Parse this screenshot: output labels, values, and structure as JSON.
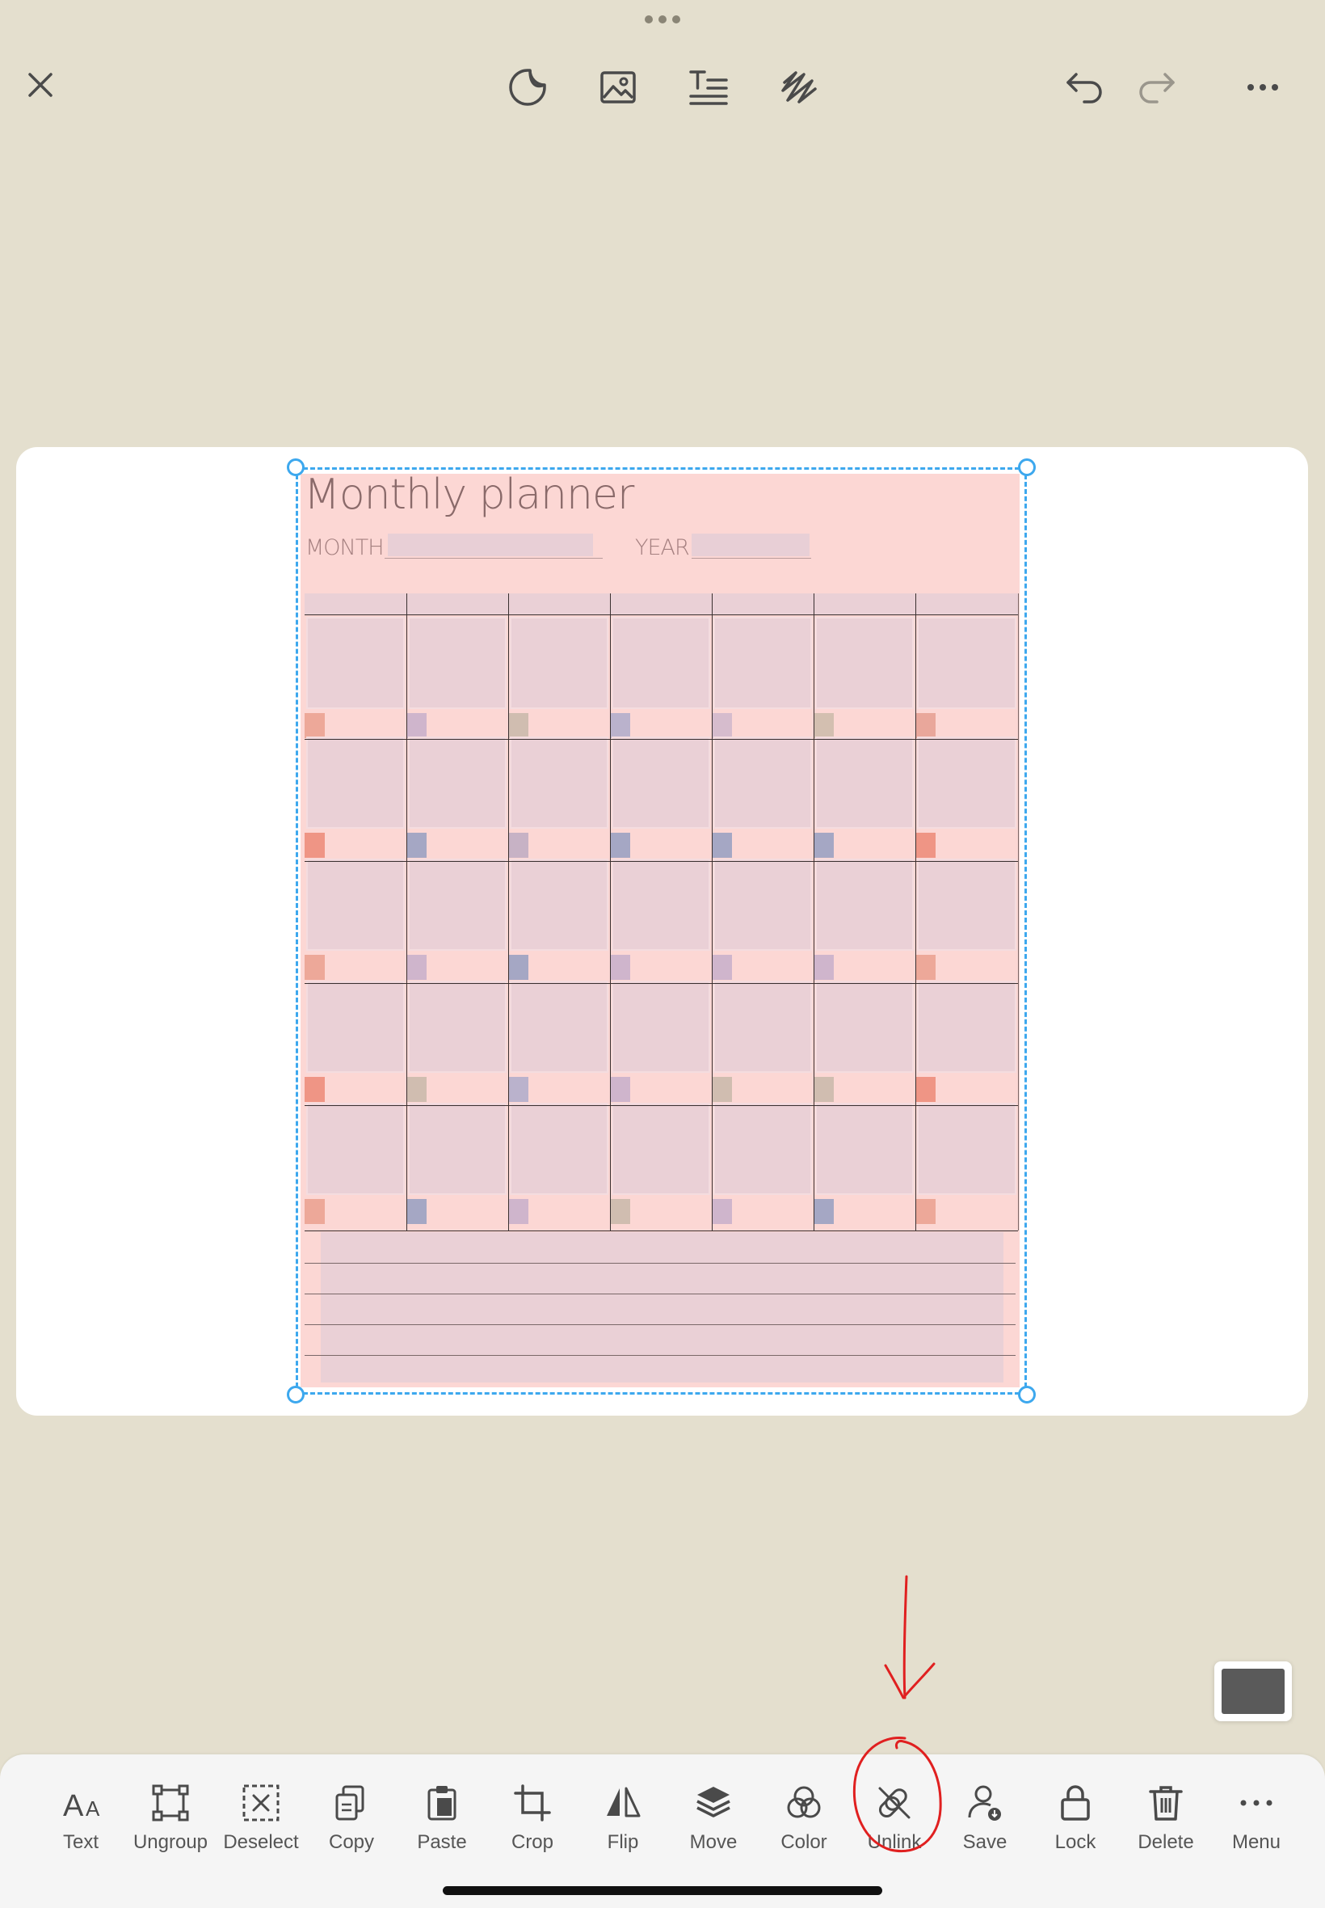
{
  "planner": {
    "title": "Monthly planner",
    "month_label": "MONTH",
    "year_label": "YEAR",
    "marker_colors": [
      [
        "#eda899",
        "#cfb5cc",
        "#d0bdb0",
        "#bab2cc",
        "#d6bccd",
        "#d3bfb0",
        "#e9a79b"
      ],
      [
        "#ef9585",
        "#a5a7c4",
        "#c7b2c5",
        "#a5a7c4",
        "#a5a7c4",
        "#a5a7c4",
        "#ef9585"
      ],
      [
        "#eda899",
        "#cfb5cc",
        "#a5a7c4",
        "#cfb5cc",
        "#cfb5cc",
        "#cfb5cc",
        "#eda899"
      ],
      [
        "#ef9585",
        "#d0bdb0",
        "#bab2cc",
        "#cfb5cc",
        "#d0bdb0",
        "#d0bdb0",
        "#ef9585"
      ],
      [
        "#eda899",
        "#a5a7c4",
        "#cfb5cc",
        "#d0bdb0",
        "#cfb5cc",
        "#a5a7c4",
        "#eda899"
      ]
    ]
  },
  "toolbar": {
    "top_icons": [
      "close-icon",
      "sticker-icon",
      "image-icon",
      "text-format-icon",
      "scribble-icon",
      "undo-icon",
      "redo-icon",
      "more-icon"
    ]
  },
  "bottom_tools": [
    {
      "id": "text",
      "label": "Text",
      "icon": "text-icon"
    },
    {
      "id": "ungroup",
      "label": "Ungroup",
      "icon": "ungroup-icon"
    },
    {
      "id": "deselect",
      "label": "Deselect",
      "icon": "deselect-icon"
    },
    {
      "id": "copy",
      "label": "Copy",
      "icon": "copy-icon"
    },
    {
      "id": "paste",
      "label": "Paste",
      "icon": "paste-icon"
    },
    {
      "id": "crop",
      "label": "Crop",
      "icon": "crop-icon"
    },
    {
      "id": "flip",
      "label": "Flip",
      "icon": "flip-icon"
    },
    {
      "id": "move",
      "label": "Move",
      "icon": "layers-icon"
    },
    {
      "id": "color",
      "label": "Color",
      "icon": "color-icon"
    },
    {
      "id": "unlink",
      "label": "Unlink",
      "icon": "unlink-icon"
    },
    {
      "id": "save",
      "label": "Save",
      "icon": "save-icon"
    },
    {
      "id": "lock",
      "label": "Lock",
      "icon": "lock-icon"
    },
    {
      "id": "delete",
      "label": "Delete",
      "icon": "trash-icon"
    },
    {
      "id": "menu",
      "label": "Menu",
      "icon": "more-icon"
    }
  ],
  "colors": {
    "selection": "#3da8ee",
    "annotation": "#e02020",
    "background": "#e4dfce",
    "page": "#fcd7d4"
  }
}
